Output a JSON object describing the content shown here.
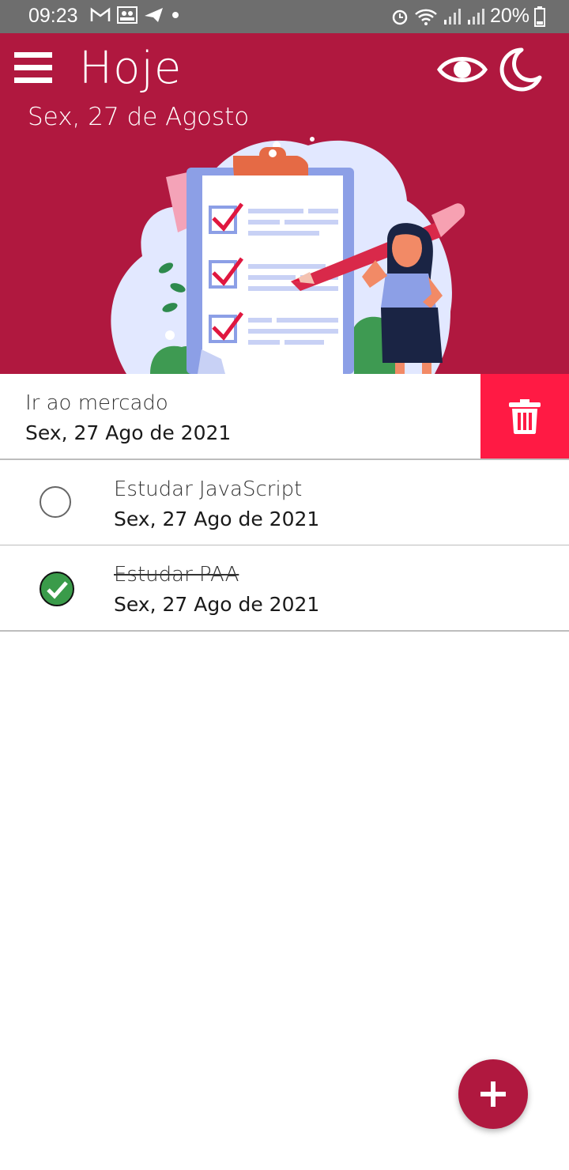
{
  "status_bar": {
    "time": "09:23",
    "battery": "20%",
    "icons": [
      "gmail-icon",
      "contacts-icon",
      "send-icon",
      "dot-icon",
      "alarm-icon",
      "wifi-icon",
      "signal-icon",
      "signal-icon",
      "battery-icon"
    ]
  },
  "header": {
    "title": "Hoje",
    "date": "Sex, 27 de Agosto",
    "bg_color": "#b0183f",
    "icons": [
      "menu-icon",
      "eye-icon",
      "moon-icon"
    ]
  },
  "tasks": [
    {
      "name": "Ir ao mercado",
      "date": "Sex, 27 Ago de 2021",
      "state": "swiped",
      "action": "trash-icon"
    },
    {
      "name": "Estudar JavaScript",
      "date": "Sex, 27 Ago de 2021",
      "done": false
    },
    {
      "name": "Estudar PAA",
      "date": "Sex, 27 Ago de 2021",
      "done": true
    }
  ],
  "colors": {
    "accent": "#b0183f",
    "delete": "#ff1a44",
    "done": "#3a9b4a"
  },
  "fab": {
    "icon": "plus-icon"
  }
}
